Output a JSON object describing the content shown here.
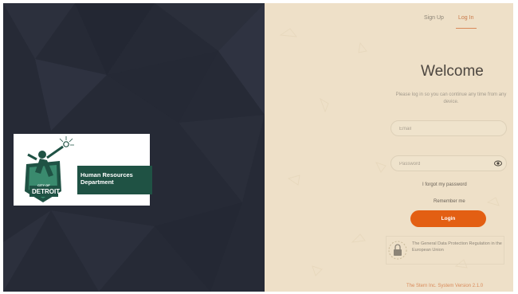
{
  "logo": {
    "city_of": "CITY OF",
    "city": "DETROIT",
    "department_line1": "Human Resources",
    "department_line2": "Department"
  },
  "auth_tabs": [
    {
      "label": "Sign Up"
    },
    {
      "label": "Log In"
    }
  ],
  "welcome": "Welcome",
  "subtitle": "Please log in so you can continue any time from any device.",
  "email": {
    "placeholder": "Email",
    "value": ""
  },
  "password": {
    "placeholder": "Password",
    "value": ""
  },
  "forgot_password": "I forgot my password",
  "remember_me": "Remember me",
  "login_button": "Login",
  "gdpr_text": "The General Data Protection Regulation in the European Union",
  "bottom_link": "The Stern Inc. System Version 2.1.0"
}
